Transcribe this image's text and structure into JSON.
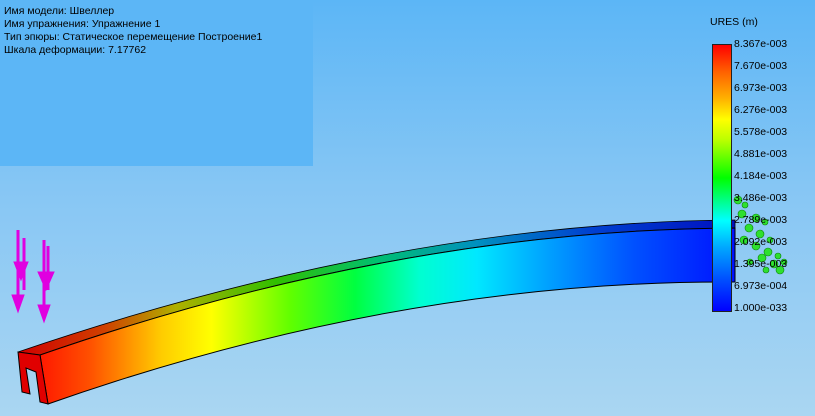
{
  "info": {
    "model_name": "Имя модели: Швеллер",
    "study_name": "Имя упражнения: Упражнение 1",
    "plot_type": "Тип эпюры: Статическое перемещение Построение1",
    "deformation_scale": "Шкала деформации: 7.17762"
  },
  "legend": {
    "title": "URES (m)",
    "labels": [
      "8.367e-003",
      "7.670e-003",
      "6.973e-003",
      "6.276e-003",
      "5.578e-003",
      "4.881e-003",
      "4.184e-003",
      "3.486e-003",
      "2.789e-003",
      "2.092e-003",
      "1.395e-003",
      "6.973e-004",
      "1.000e-033"
    ]
  },
  "colors": {
    "background": "#86c6f4",
    "info_panel": "#5cb6f6",
    "load_arrows": "#e000e0",
    "fixtures": "#2ee02e"
  }
}
